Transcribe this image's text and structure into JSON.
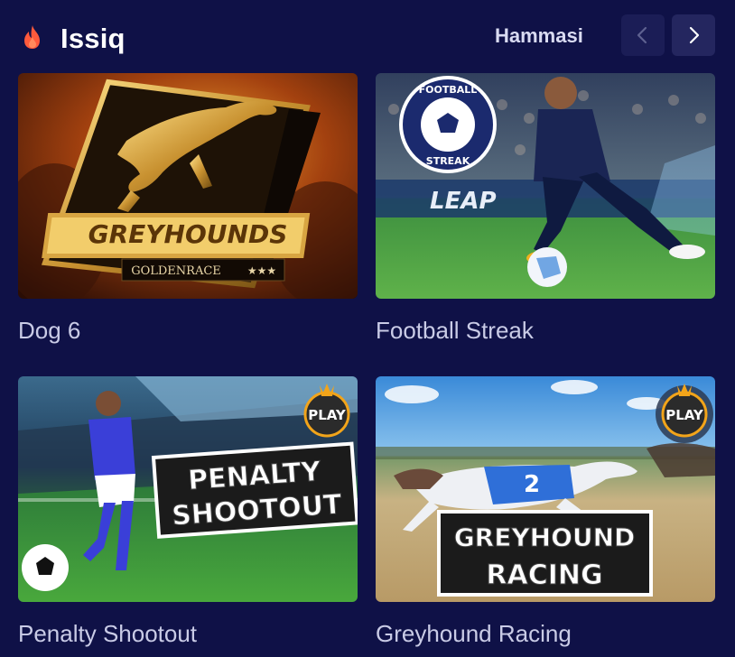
{
  "section": {
    "title": "Issiq",
    "see_all_label": "Hammasi",
    "icon": "fire-icon",
    "accent_color": "#ff5a3c"
  },
  "nav": {
    "prev_icon": "chevron-left-icon",
    "next_icon": "chevron-right-icon"
  },
  "games": [
    {
      "name": "Dog 6",
      "art": {
        "headline": "GREYHOUNDS",
        "brand": "GOLDENRACE",
        "stars": "★★★"
      }
    },
    {
      "name": "Football Streak",
      "art": {
        "badge_top": "FOOTBALL",
        "badge_bottom": "STREAK",
        "sponsor": "LEAP"
      }
    },
    {
      "name": "Penalty Shootout",
      "art": {
        "line1": "PENALTY",
        "line2": "SHOOTOUT",
        "badge": "PLAY"
      }
    },
    {
      "name": "Greyhound Racing",
      "art": {
        "line1": "GREYHOUND",
        "line2": "RACING",
        "badge": "PLAY",
        "bib": "2"
      }
    }
  ]
}
